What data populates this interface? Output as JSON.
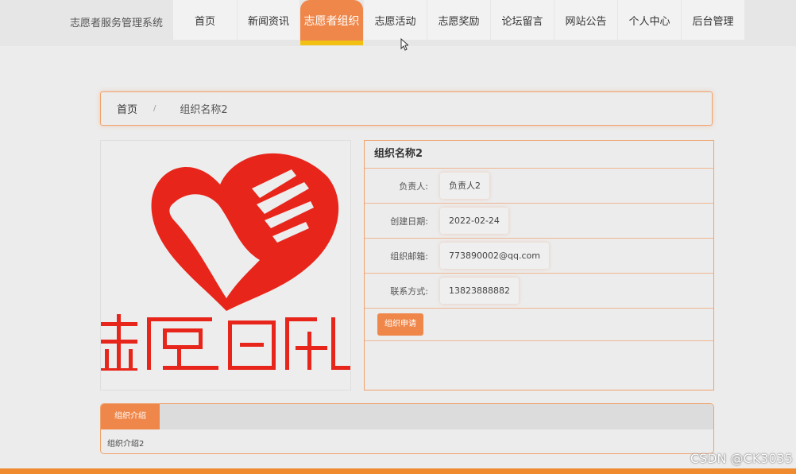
{
  "brand": "志愿者服务管理系统",
  "nav": [
    {
      "label": "首页"
    },
    {
      "label": "新闻资讯"
    },
    {
      "label": "志愿者组织",
      "active": true
    },
    {
      "label": "志愿活动"
    },
    {
      "label": "志愿奖励"
    },
    {
      "label": "论坛留言"
    },
    {
      "label": "网站公告"
    },
    {
      "label": "个人中心"
    },
    {
      "label": "后台管理"
    }
  ],
  "breadcrumb": {
    "home": "首页",
    "separator": "/",
    "current": "组织名称2"
  },
  "logo": {
    "icon": "heart-hand-logo",
    "text": "志愿日创",
    "color": "#e8251b"
  },
  "org": {
    "name": "组织名称2",
    "fields": [
      {
        "label": "负责人:",
        "value": "负责人2"
      },
      {
        "label": "创建日期:",
        "value": "2022-02-24"
      },
      {
        "label": "组织邮箱:",
        "value": "773890002@qq.com"
      },
      {
        "label": "联系方式:",
        "value": "13823888882"
      }
    ],
    "apply_label": "组织申请"
  },
  "tab": {
    "label": "组织介绍",
    "content": "组织介绍2"
  },
  "watermark": "CSDN @CK3035",
  "colors": {
    "accent": "#f0874a",
    "underline": "#f2c012",
    "border": "#f0a26c"
  }
}
